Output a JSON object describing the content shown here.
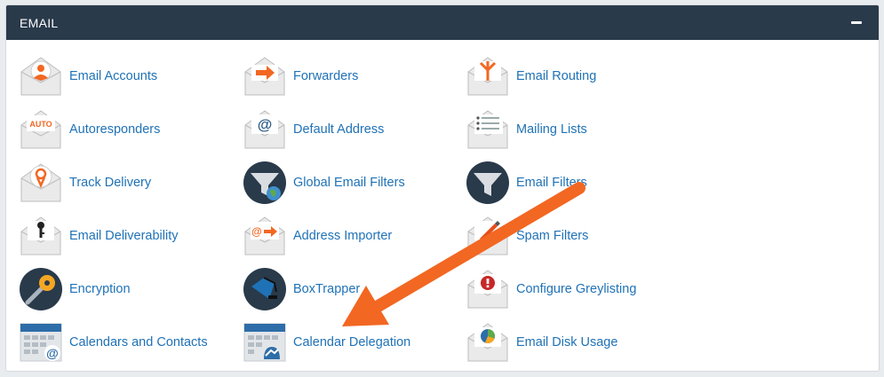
{
  "section": {
    "title": "EMAIL",
    "accent": "#1f72b6",
    "header_bg": "#293a4a"
  },
  "items": [
    {
      "label": "Email Accounts",
      "icon": "email-accounts-icon"
    },
    {
      "label": "Forwarders",
      "icon": "forwarders-icon"
    },
    {
      "label": "Email Routing",
      "icon": "email-routing-icon"
    },
    {
      "label": "Autoresponders",
      "icon": "autoresponders-icon",
      "badge": "AUTO"
    },
    {
      "label": "Default Address",
      "icon": "default-address-icon",
      "badge": "@"
    },
    {
      "label": "Mailing Lists",
      "icon": "mailing-lists-icon"
    },
    {
      "label": "Track Delivery",
      "icon": "track-delivery-icon"
    },
    {
      "label": "Global Email Filters",
      "icon": "global-email-filters-icon"
    },
    {
      "label": "Email Filters",
      "icon": "email-filters-icon"
    },
    {
      "label": "Email Deliverability",
      "icon": "email-deliverability-icon"
    },
    {
      "label": "Address Importer",
      "icon": "address-importer-icon",
      "badge": "@"
    },
    {
      "label": "Spam Filters",
      "icon": "spam-filters-icon"
    },
    {
      "label": "Encryption",
      "icon": "encryption-icon"
    },
    {
      "label": "BoxTrapper",
      "icon": "boxtrapper-icon"
    },
    {
      "label": "Configure Greylisting",
      "icon": "configure-greylisting-icon",
      "badge": "!"
    },
    {
      "label": "Calendars and Contacts",
      "icon": "calendars-and-contacts-icon",
      "badge": "@"
    },
    {
      "label": "Calendar Delegation",
      "icon": "calendar-delegation-icon"
    },
    {
      "label": "Email Disk Usage",
      "icon": "email-disk-usage-icon"
    }
  ]
}
